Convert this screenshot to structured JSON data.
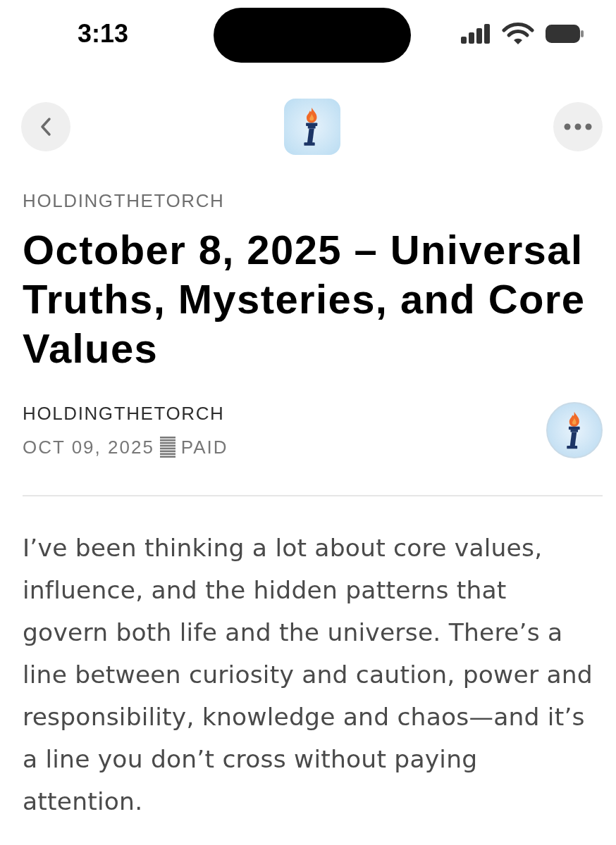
{
  "status_bar": {
    "time": "3:13"
  },
  "publication": "HOLDINGTHETORCH",
  "title": "October 8, 2025 – Universal Truths, Mysteries, and Core Values",
  "byline": {
    "author": "HOLDINGTHETORCH",
    "date": "OCT 09, 2025",
    "access": "PAID"
  },
  "body": "I’ve been thinking a lot about core values, influence, and the hidden patterns that govern both life and the universe. There’s a line between curiosity and caution, power and responsibility, knowledge and chaos—and it’s a line you don’t cross without paying attention."
}
